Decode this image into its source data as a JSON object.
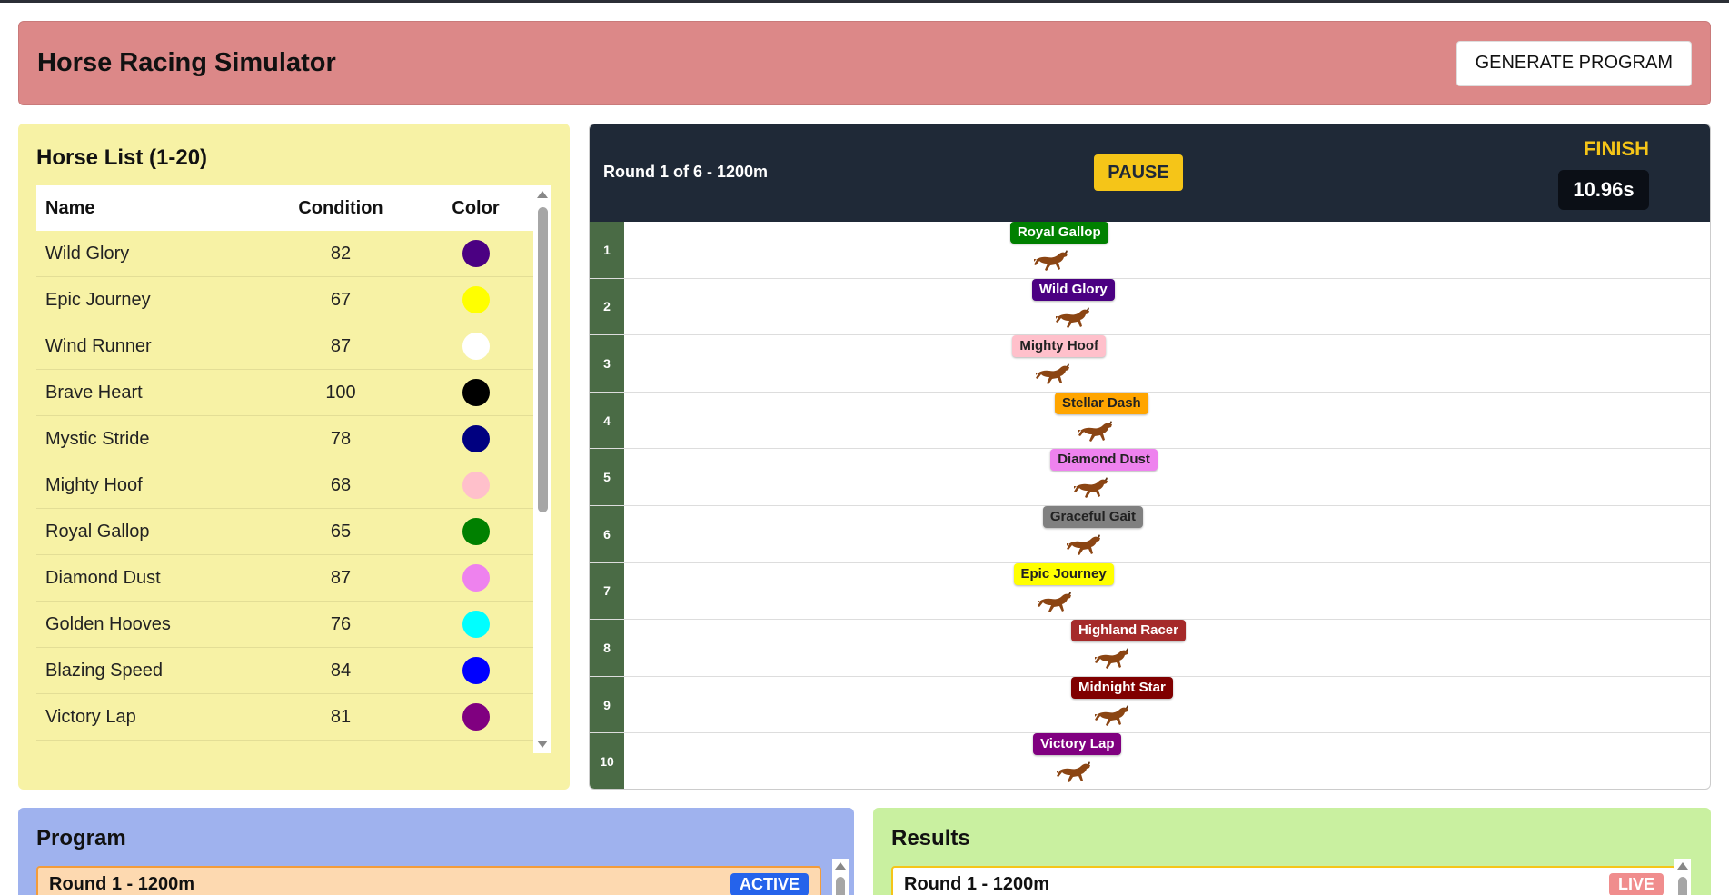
{
  "header": {
    "title": "Horse Racing Simulator",
    "generate_label": "GENERATE PROGRAM"
  },
  "horse_list": {
    "title": "Horse List (1-20)",
    "columns": [
      "Name",
      "Condition",
      "Color"
    ],
    "rows": [
      {
        "name": "Wild Glory",
        "condition": "82",
        "color": "#4b0082"
      },
      {
        "name": "Epic Journey",
        "condition": "67",
        "color": "#ffff00"
      },
      {
        "name": "Wind Runner",
        "condition": "87",
        "color": "#ffffff"
      },
      {
        "name": "Brave Heart",
        "condition": "100",
        "color": "#000000"
      },
      {
        "name": "Mystic Stride",
        "condition": "78",
        "color": "#000080"
      },
      {
        "name": "Mighty Hoof",
        "condition": "68",
        "color": "#ffc0cb"
      },
      {
        "name": "Royal Gallop",
        "condition": "65",
        "color": "#008000"
      },
      {
        "name": "Diamond Dust",
        "condition": "87",
        "color": "#ee82ee"
      },
      {
        "name": "Golden Hooves",
        "condition": "76",
        "color": "#00ffff"
      },
      {
        "name": "Blazing Speed",
        "condition": "84",
        "color": "#0000ff"
      },
      {
        "name": "Victory Lap",
        "condition": "81",
        "color": "#800080"
      }
    ]
  },
  "track": {
    "round_info": "Round 1 of 6 - 1200m",
    "pause_label": "PAUSE",
    "finish_label": "FINISH",
    "timer": "10.96s",
    "lanes": [
      {
        "num": "1",
        "horse": "Royal Gallop",
        "bg": "#008000",
        "fg": "#ffffff",
        "progress": 0.355
      },
      {
        "num": "2",
        "horse": "Wild Glory",
        "bg": "#4b0082",
        "fg": "#ffffff",
        "progress": 0.375
      },
      {
        "num": "3",
        "horse": "Mighty Hoof",
        "bg": "#ffc0cb",
        "fg": "#222222",
        "progress": 0.357
      },
      {
        "num": "4",
        "horse": "Stellar Dash",
        "bg": "#ffa500",
        "fg": "#222222",
        "progress": 0.396
      },
      {
        "num": "5",
        "horse": "Diamond Dust",
        "bg": "#ee82ee",
        "fg": "#222222",
        "progress": 0.392
      },
      {
        "num": "6",
        "horse": "Graceful Gait",
        "bg": "#808080",
        "fg": "#222222",
        "progress": 0.385
      },
      {
        "num": "7",
        "horse": "Epic Journey",
        "bg": "#ffff00",
        "fg": "#222222",
        "progress": 0.358
      },
      {
        "num": "8",
        "horse": "Highland Racer",
        "bg": "#a52a2a",
        "fg": "#ffffff",
        "progress": 0.411
      },
      {
        "num": "9",
        "horse": "Midnight Star",
        "bg": "#800000",
        "fg": "#ffffff",
        "progress": 0.411
      },
      {
        "num": "10",
        "horse": "Victory Lap",
        "bg": "#800080",
        "fg": "#ffffff",
        "progress": 0.376
      }
    ]
  },
  "program": {
    "title": "Program",
    "round_label": "Round 1 - 1200m",
    "badge": "ACTIVE"
  },
  "results": {
    "title": "Results",
    "round_label": "Round 1 - 1200m",
    "badge": "LIVE"
  }
}
